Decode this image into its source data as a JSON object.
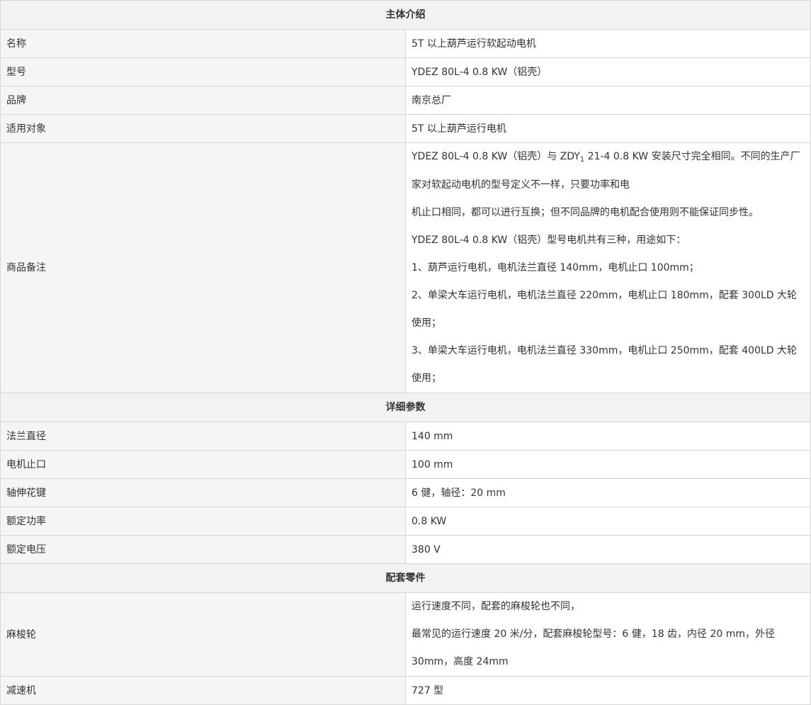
{
  "sections": {
    "main_intro": "主体介绍",
    "detail_params": "详细参数",
    "accessories": "配套零件"
  },
  "main": {
    "name": {
      "label": "名称",
      "value": "5T 以上葫芦运行软起动电机"
    },
    "model": {
      "label": "型号",
      "value": "YDEZ 80L-4 0.8 KW（铝壳）"
    },
    "brand": {
      "label": "品牌",
      "value": "南京总厂"
    },
    "applicable": {
      "label": "适用对象",
      "value": "5T 以上葫芦运行电机"
    },
    "notes": {
      "label": "商品备注",
      "line1a": "YDEZ 80L-4 0.8 KW（铝壳）与 ZDY",
      "line1_sub": "1",
      "line1b": " 21-4 0.8 KW 安装尺寸完全相同。不同的生产厂家对软起动电机的型号定义不一样，只要功率和电",
      "line2": "机止口相同，都可以进行互换；但不同品牌的电机配合使用则不能保证同步性。",
      "line3": "YDEZ 80L-4 0.8 KW（铝壳）型号电机共有三种，用途如下：",
      "line4": "1、葫芦运行电机，电机法兰直径 140mm，电机止口 100mm；",
      "line5": "2、单梁大车运行电机，电机法兰直径 220mm，电机止口 180mm，配套 300LD 大轮使用；",
      "line6": "3、单梁大车运行电机，电机法兰直径 330mm，电机止口 250mm，配套 400LD 大轮使用；"
    }
  },
  "details": {
    "flange": {
      "label": "法兰直径",
      "value": "140 mm"
    },
    "spigot": {
      "label": "电机止口",
      "value": "100 mm"
    },
    "spline": {
      "label": "轴伸花键",
      "value": "6 健，轴径：20 mm"
    },
    "power": {
      "label": "额定功率",
      "value": "0.8 KW"
    },
    "voltage": {
      "label": "额定电压",
      "value": "380 V"
    }
  },
  "parts": {
    "wheel": {
      "label": "麻梭轮",
      "line1": "运行速度不同，配套的麻梭轮也不同，",
      "line2": "最常见的运行速度 20 米/分，配套麻梭轮型号：6 健，18 齿，内径 20 mm，外径 30mm，高度 24mm"
    },
    "reducer": {
      "label": "减速机",
      "value": "727 型"
    }
  }
}
